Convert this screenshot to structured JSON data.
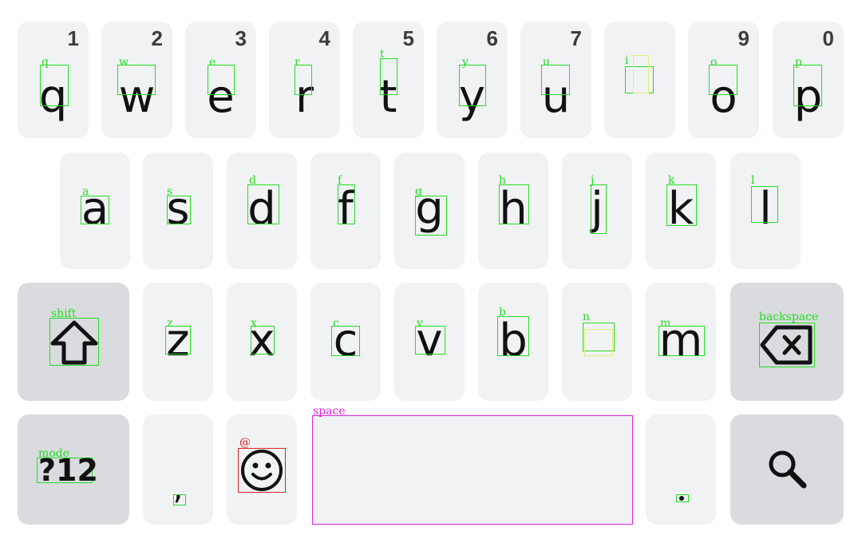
{
  "keyboard": {
    "row1": [
      {
        "id": "q",
        "char": "q",
        "hint": "1",
        "label": "q"
      },
      {
        "id": "w",
        "char": "w",
        "hint": "2",
        "label": "w"
      },
      {
        "id": "e",
        "char": "e",
        "hint": "3",
        "label": "e"
      },
      {
        "id": "r",
        "char": "r",
        "hint": "4",
        "label": "r"
      },
      {
        "id": "t",
        "char": "t",
        "hint": "5",
        "label": "t"
      },
      {
        "id": "y",
        "char": "y",
        "hint": "6",
        "label": "y"
      },
      {
        "id": "u",
        "char": "u",
        "hint": "7",
        "label": "u"
      },
      {
        "id": "i",
        "char": "",
        "hint": "",
        "label": "i"
      },
      {
        "id": "o",
        "char": "o",
        "hint": "9",
        "label": "o"
      },
      {
        "id": "p",
        "char": "p",
        "hint": "0",
        "label": "p"
      }
    ],
    "row2": [
      {
        "id": "a",
        "char": "a",
        "label": "a"
      },
      {
        "id": "s",
        "char": "s",
        "label": "s"
      },
      {
        "id": "d",
        "char": "d",
        "label": "d"
      },
      {
        "id": "f",
        "char": "f",
        "label": "f"
      },
      {
        "id": "g",
        "char": "g",
        "label": "g"
      },
      {
        "id": "h",
        "char": "h",
        "label": "h"
      },
      {
        "id": "j",
        "char": "j",
        "label": "j"
      },
      {
        "id": "k",
        "char": "k",
        "label": "k"
      },
      {
        "id": "l",
        "char": "l",
        "label": "l"
      }
    ],
    "row3": [
      {
        "id": "z",
        "char": "z",
        "label": "z"
      },
      {
        "id": "x",
        "char": "x",
        "label": "x"
      },
      {
        "id": "c",
        "char": "c",
        "label": "c"
      },
      {
        "id": "v",
        "char": "v",
        "label": "v"
      },
      {
        "id": "b",
        "char": "b",
        "label": "b"
      },
      {
        "id": "n",
        "char": "",
        "label": "n"
      },
      {
        "id": "m",
        "char": "m",
        "label": "m"
      }
    ],
    "shift": {
      "label": "shift",
      "icon": "shift-arrow-icon"
    },
    "backspace": {
      "label": "backspace",
      "icon": "backspace-icon"
    },
    "mode": {
      "label": "mode",
      "text": "?12"
    },
    "comma": {
      "char": ","
    },
    "emoji": {
      "label": "@",
      "icon": "smiley-face-icon"
    },
    "space": {
      "label": "space"
    },
    "period": {
      "char": "."
    },
    "search": {
      "icon": "search-icon"
    }
  },
  "colors": {
    "key_bg": "#f1f2f4",
    "key_dark_bg": "#dadbdf",
    "debug_green": "#22dd22",
    "debug_magenta": "#dd22dd",
    "debug_red": "#dd2222"
  }
}
